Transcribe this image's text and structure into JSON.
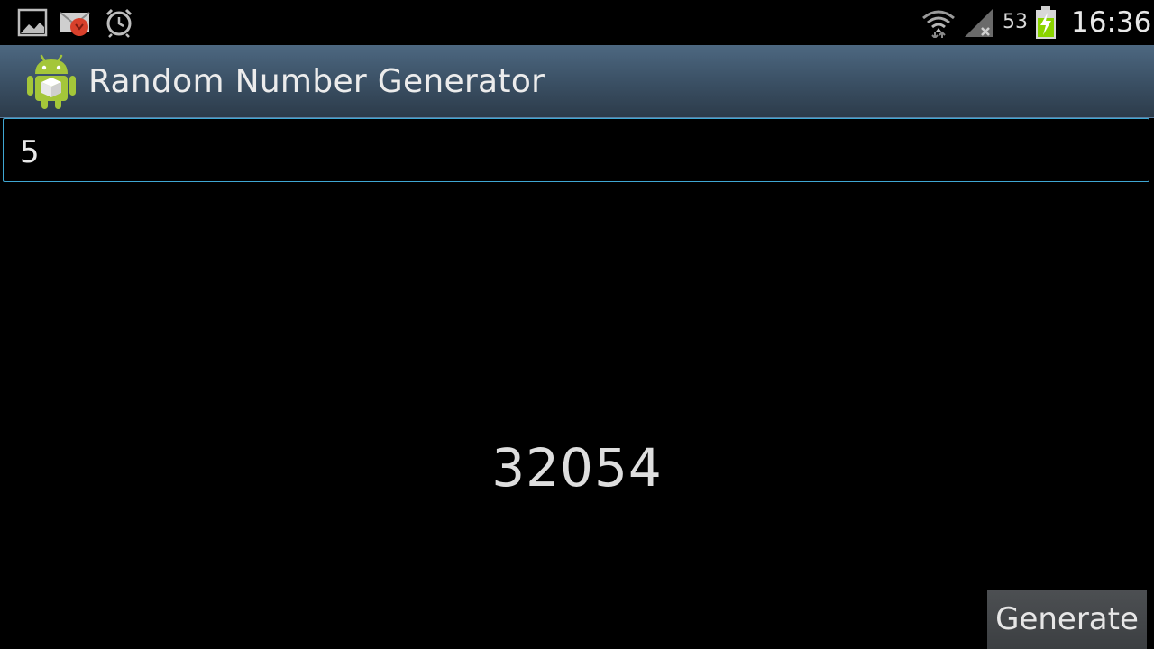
{
  "status_bar": {
    "icons_left": [
      "gallery-icon",
      "mail-notification-icon",
      "alarm-icon"
    ],
    "icons_right": [
      "wifi-icon",
      "signal-icon",
      "battery-charging-icon"
    ],
    "battery_percent": "53",
    "time": "16:36"
  },
  "action_bar": {
    "app_icon": "android-app-icon",
    "title": "Random Number Generator"
  },
  "input": {
    "value": "5"
  },
  "result": {
    "value": "32054"
  },
  "buttons": {
    "generate_label": "Generate"
  },
  "colors": {
    "action_bar": "#3d5368",
    "input_border": "#3fa7d3",
    "battery": "#8bd400",
    "android_green": "#a4c639"
  }
}
